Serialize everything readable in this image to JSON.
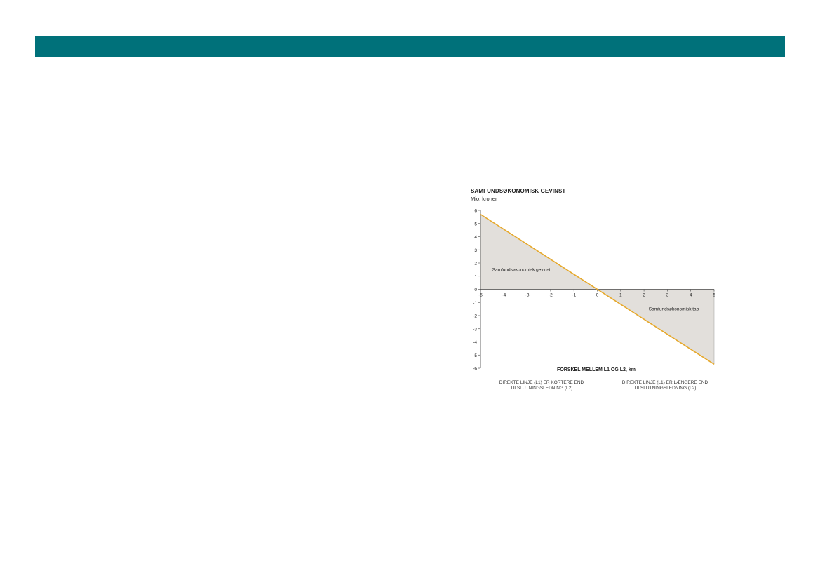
{
  "header": {
    "bar_color": "#00717a"
  },
  "chart_data": {
    "type": "area",
    "title": "SAMFUNDSØKONOMISK GEVINST",
    "subtitle": "Mio. kroner",
    "xlabel": "FORSKEL MELLEM L1 OG L2, km",
    "ylabel": "",
    "x_ticks": [
      "-5",
      "-4",
      "-3",
      "-2",
      "-1",
      "0",
      "1",
      "2",
      "3",
      "4",
      "5"
    ],
    "y_ticks": [
      "6",
      "5",
      "4",
      "3",
      "2",
      "1",
      "0",
      "-1",
      "-2",
      "-3",
      "-4",
      "-5",
      "-6"
    ],
    "xlim": [
      -5,
      5
    ],
    "ylim": [
      -6,
      6
    ],
    "line": {
      "x": [
        -5,
        5
      ],
      "y": [
        5.7,
        -5.7
      ],
      "color": "#e6a82a"
    },
    "fill_color": "#e2dfdb",
    "annotations": {
      "gain": "Samfundsøkonomisk gevinst",
      "loss": "Samfundsøkonomisk tab"
    },
    "notes": {
      "left": "DIREKTE LINJE (L1) ER KORTERE END TILSLUTNINGSLEDNING (L2)",
      "right": "DIREKTE LINJE (L1) ER LÆNGERE END TILSLUTNINGSLEDNING (L2)"
    }
  }
}
